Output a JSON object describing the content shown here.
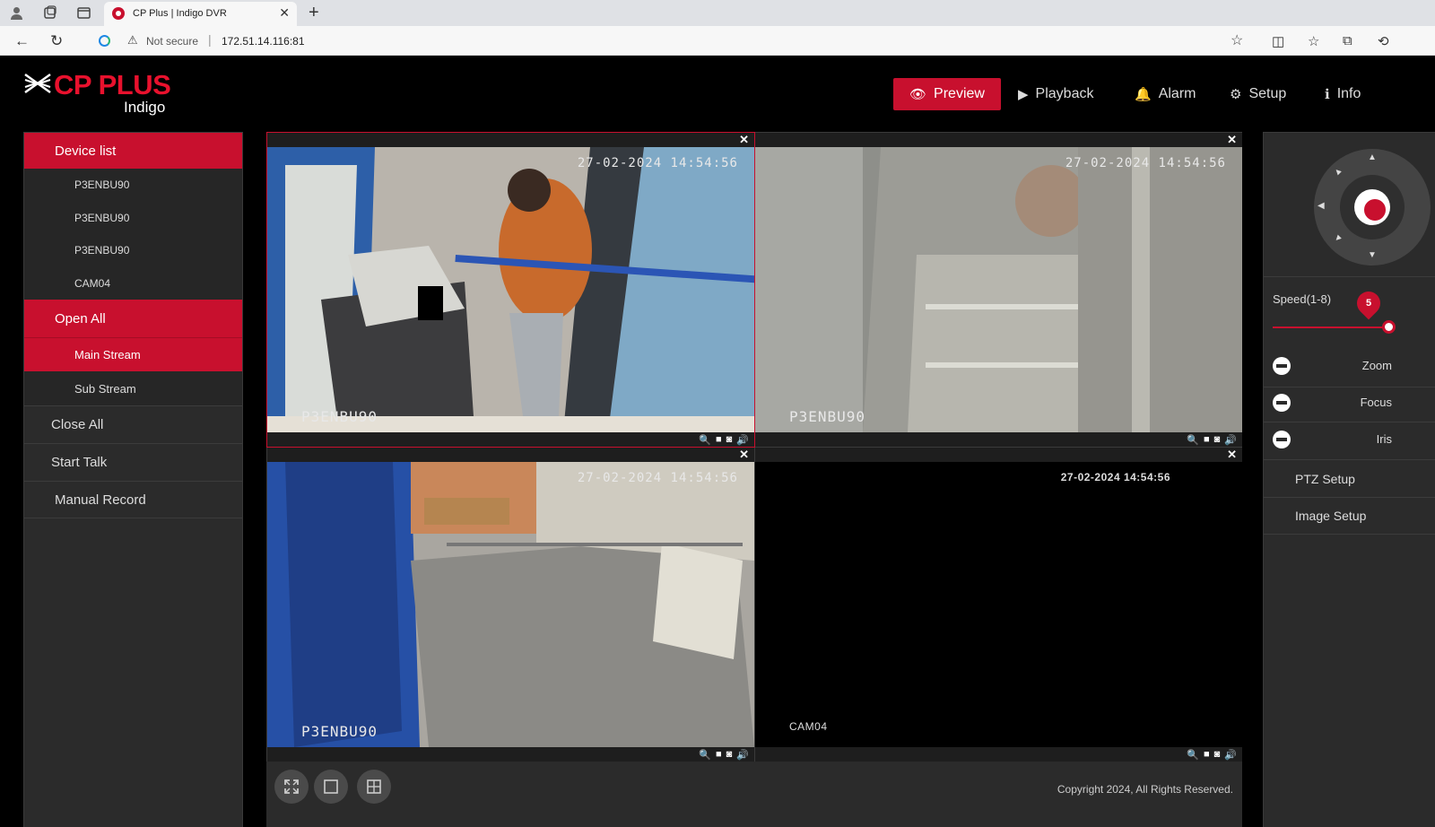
{
  "browser": {
    "tab_title": "CP Plus | Indigo DVR",
    "security_label": "Not secure",
    "url": "172.51.14.116:81"
  },
  "app": {
    "logo_brand": "CP PLUS",
    "logo_sub": "Indigo",
    "nav": {
      "preview": "Preview",
      "playback": "Playback",
      "alarm": "Alarm",
      "setup": "Setup",
      "info": "Info"
    },
    "sidebar": {
      "device_list_label": "Device list",
      "devices": [
        "P3ENBU90",
        "P3ENBU90",
        "P3ENBU90",
        "CAM04"
      ],
      "open_all": "Open All",
      "main_stream": "Main Stream",
      "sub_stream": "Sub Stream",
      "close_all": "Close All",
      "start_talk": "Start Talk",
      "manual_record": "Manual Record"
    },
    "cameras": [
      {
        "timestamp": "27-02-2024 14:54:56",
        "name": "P3ENBU90"
      },
      {
        "timestamp": "27-02-2024 14:54:56",
        "name": "P3ENBU90"
      },
      {
        "timestamp": "27-02-2024 14:54:56",
        "name": "P3ENBU90"
      },
      {
        "timestamp": "27-02-2024 14:54:56",
        "name": "CAM04"
      }
    ],
    "copyright": "Copyright 2024, All Rights Reserved.",
    "ptz": {
      "speed_label": "Speed(1-8)",
      "speed_value": "5",
      "speed_fraction": 1.0,
      "zoom": "Zoom",
      "focus": "Focus",
      "iris": "Iris",
      "ptz_setup": "PTZ Setup",
      "image_setup": "Image Setup"
    },
    "colors": {
      "accent": "#c8102e",
      "panel": "#2b2b2b"
    }
  }
}
